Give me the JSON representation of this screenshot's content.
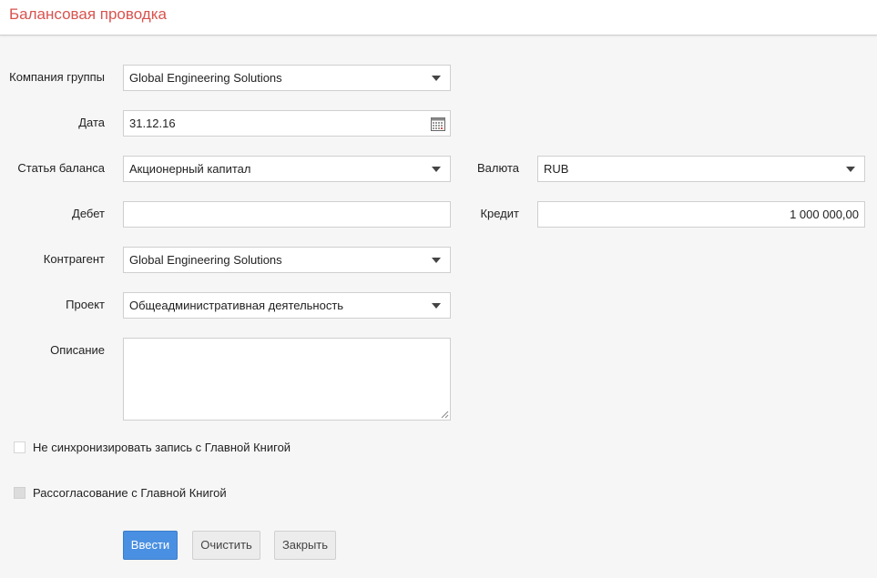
{
  "header": {
    "title": "Балансовая проводка"
  },
  "form": {
    "company": {
      "label": "Компания группы",
      "value": "Global Engineering Solutions"
    },
    "date": {
      "label": "Дата",
      "value": "31.12.16"
    },
    "balance_item": {
      "label": "Статья баланса",
      "value": "Акционерный капитал"
    },
    "currency": {
      "label": "Валюта",
      "value": "RUB"
    },
    "debit": {
      "label": "Дебет",
      "value": ""
    },
    "credit": {
      "label": "Кредит",
      "value": "1 000 000,00"
    },
    "counterparty": {
      "label": "Контрагент",
      "value": "Global Engineering Solutions"
    },
    "project": {
      "label": "Проект",
      "value": "Общеадминистративная деятельность"
    },
    "description": {
      "label": "Описание",
      "value": ""
    }
  },
  "checkboxes": {
    "no_sync": {
      "label": "Не синхронизировать запись с Главной Книгой",
      "checked": false
    },
    "mismatch": {
      "label": "Рассогласование с Главной Книгой",
      "checked": false,
      "disabled": true
    }
  },
  "buttons": {
    "submit": "Ввести",
    "clear": "Очистить",
    "close": "Закрыть"
  },
  "colors": {
    "title": "#d9534f",
    "primary_button": "#4a90e2",
    "background": "#f6f6f6"
  }
}
